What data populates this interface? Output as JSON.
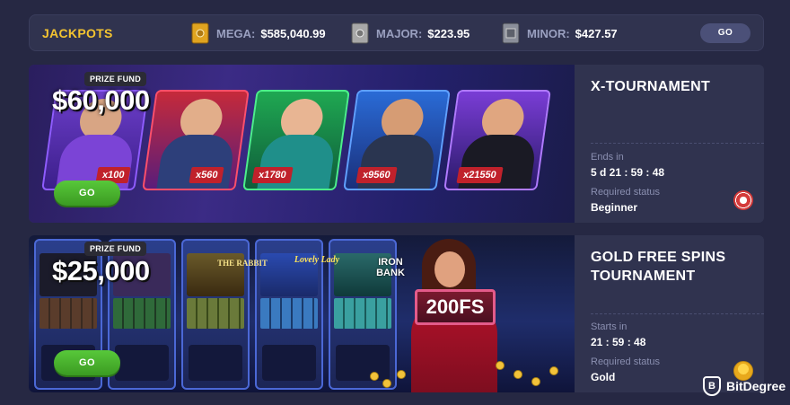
{
  "jackpots": {
    "title": "JACKPOTS",
    "items": [
      {
        "label": "MEGA:",
        "value": "$585,040.99",
        "icon": "gold-safe-icon"
      },
      {
        "label": "MAJOR:",
        "value": "$223.95",
        "icon": "silver-safe-icon"
      },
      {
        "label": "MINOR:",
        "value": "$427.57",
        "icon": "steel-safe-icon"
      }
    ],
    "go_label": "GO"
  },
  "tournaments": [
    {
      "name": "X-TOURNAMENT",
      "banner": {
        "prize_label": "PRIZE FUND",
        "prize_amount": "$60,000",
        "go_label": "GO",
        "multipliers": [
          "x100",
          "x560",
          "x1780",
          "x9560",
          "x21550"
        ]
      },
      "time_label": "Ends in",
      "time_value": "5 d 21 : 59 : 48",
      "status_label": "Required status",
      "status_value": "Beginner",
      "status_icon": "poker-chip-icon"
    },
    {
      "name": "GOLD FREE SPINS TOURNAMENT",
      "banner": {
        "prize_label": "PRIZE FUND",
        "prize_amount": "$25,000",
        "go_label": "GO",
        "slot_titles": [
          "THE RABBIT",
          "Lovely Lady",
          "IRON BANK"
        ],
        "promo_sign": "200FS"
      },
      "time_label": "Starts in",
      "time_value": "21 : 59 : 48",
      "status_label": "Required status",
      "status_value": "Gold",
      "status_icon": "gold-medal-icon"
    }
  ],
  "watermark": {
    "text": "BitDegree",
    "logo_letter": "B"
  },
  "colors": {
    "background": "#262843",
    "panel": "#30334f",
    "accent_gold": "#f4c430",
    "go_green": "#4cb02e",
    "multiplier_red": "#c0212b"
  }
}
